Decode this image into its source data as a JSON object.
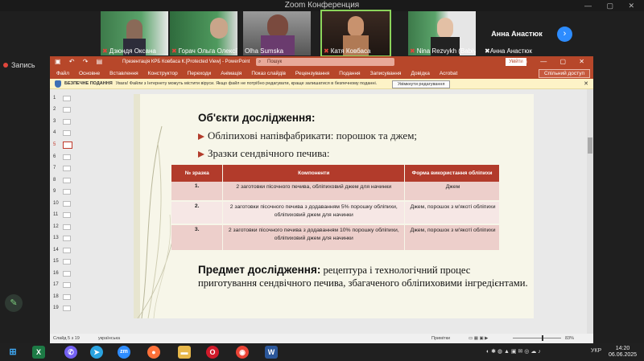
{
  "zoom": {
    "window_title": "Zoom Конференция",
    "recording_label": "Запись",
    "participants": [
      {
        "name": "Дзюндя Оксана",
        "muted": true
      },
      {
        "name": "Горач Ольга Олексіївна",
        "muted": true
      },
      {
        "name": "Olha Sumska",
        "muted": false,
        "active": true
      },
      {
        "name": "Катя Ковбаса",
        "muted": true
      },
      {
        "name": "Nina Rezvykh (Babiy)",
        "muted": true
      },
      {
        "name": "Анна Анастюк",
        "muted": true
      }
    ],
    "name_only_tile": "Анна Анастюк",
    "next_icon": "chevron-right-icon"
  },
  "powerpoint": {
    "doc_title": "Презентація КРБ Ковбаса К.[Protected View] - PowerPoint",
    "search_placeholder": "Пошук",
    "signin_label": "Увійти",
    "tabs": [
      "Файл",
      "Основне",
      "Вставлення",
      "Конструктор",
      "Переходи",
      "Анімація",
      "Показ слайдів",
      "Рецензування",
      "Подання",
      "Записування",
      "Довідка",
      "Acrobat"
    ],
    "share_label": "Спільний доступ",
    "protected_bar": {
      "title": "БЕЗПЕЧНЕ ПОДАННЯ",
      "message": "Увага! Файли з Інтернету можуть містити віруси. Якщо файл не потрібно редагувати, краще залишатися в безпечному поданні.",
      "enable_label": "Увімкнути редагування"
    },
    "thumb_numbers": [
      "1",
      "2",
      "3",
      "4",
      "5",
      "6",
      "7",
      "8",
      "9",
      "10",
      "11",
      "12",
      "13",
      "14",
      "15",
      "16",
      "17",
      "18",
      "19"
    ],
    "selected_slide": 5,
    "status": {
      "slide_info": "Слайд 5 з 19",
      "language": "українська",
      "notes": "Примітки",
      "comments": "Примітки",
      "zoom": "83%"
    }
  },
  "slide": {
    "title": "Об'єкти дослідження:",
    "bullets": [
      "Обліпихові напівфабрикати: порошок та джем;",
      "Зразки сендвічного печива:"
    ],
    "table": {
      "headers": [
        "№ зразка",
        "Компоненти",
        "Форма використання обліпихи"
      ],
      "rows": [
        {
          "num": "1.",
          "components": "2 заготовки пісочного печива, обліпиховий джем для начинки",
          "form": "Джем"
        },
        {
          "num": "2.",
          "components": "2 заготовки пісочного печива з додаванням 5% порошку обліпихи, обліпиховий джем для начинки",
          "form": "Джем, порошок з м'якоті обліпихи"
        },
        {
          "num": "3.",
          "components": "2 заготовки пісочного печива з додаванням 10% порошку обліпихи, обліпиховий джем для начинки",
          "form": "Джем, порошок з м'якоті обліпихи"
        }
      ]
    },
    "subject_label": "Предмет дослідження:",
    "subject_text": " рецептура і технологічний процес приготування сендвічного печива, збагаченого обліпиховими інгредієнтами."
  },
  "taskbar": {
    "apps": [
      "windows-icon",
      "excel-icon",
      "viber-icon",
      "telegram-icon",
      "zoom-icon",
      "firefox-icon",
      "explorer-icon",
      "opera-icon",
      "chrome-icon",
      "word-icon"
    ],
    "zoom_label": "zm",
    "lang": "УКР",
    "time": "14:20",
    "date": "06.06.2025"
  }
}
